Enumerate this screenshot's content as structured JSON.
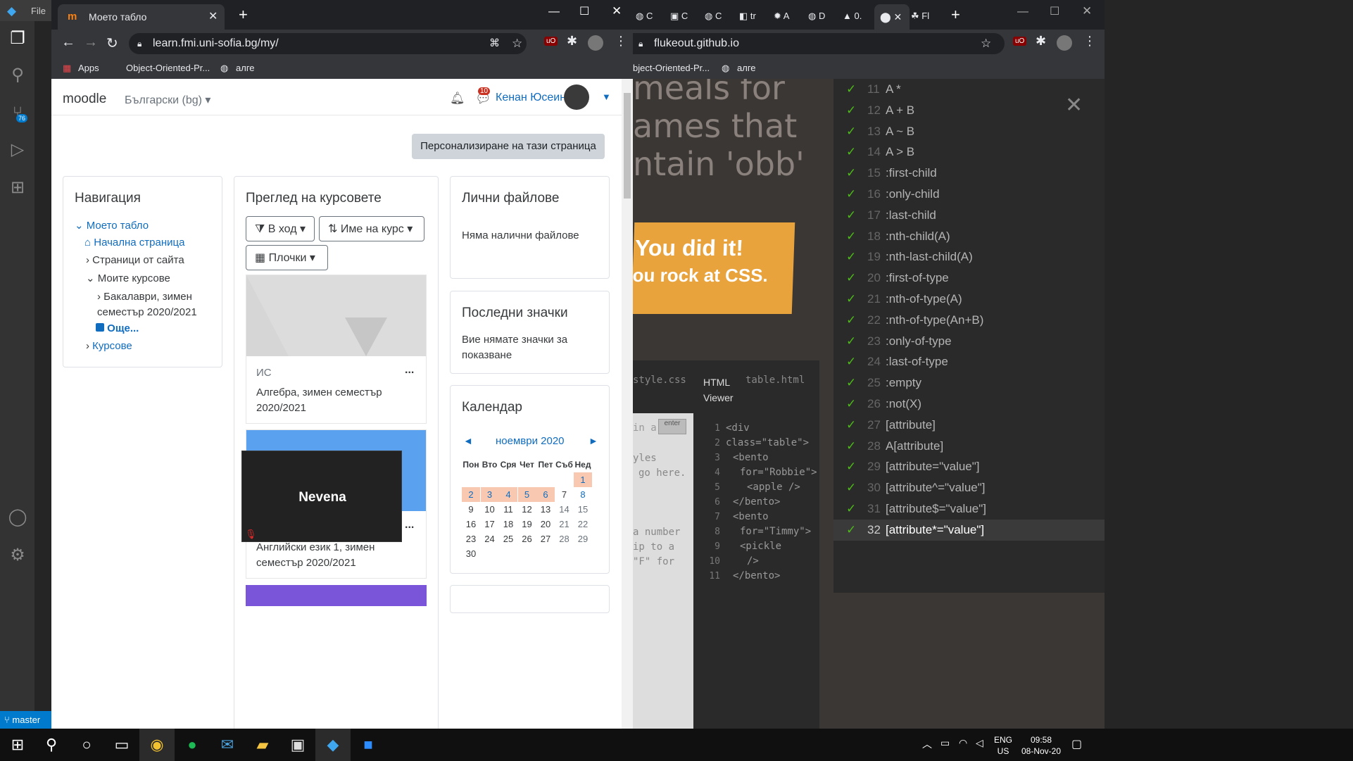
{
  "vscode": {
    "menu_file": "File",
    "scm_badge": "76",
    "branch": "master"
  },
  "chrome_left": {
    "tab_title": "Моето табло",
    "url": "learn.fmi.uni-sofia.bg/my/",
    "bookmarks": [
      "Apps",
      "Object-Oriented-Pr...",
      "алге"
    ]
  },
  "moodle": {
    "brand": "moodle",
    "language": "Български (bg)",
    "notif_count": "10",
    "user_name": "Кенан Юсеин",
    "customize_btn": "Персонализиране на тази страница",
    "navigation": {
      "title": "Навигация",
      "items": [
        "Моето табло",
        "Начална страница",
        "Страници от сайта",
        "Моите курсове",
        "Бакалаври, зимен",
        "семестър 2020/2021",
        "Още...",
        "Курсове"
      ]
    },
    "courses": {
      "title": "Преглед на курсовете",
      "filter": "В ход",
      "sort": "Име на курс",
      "view": "Плочки",
      "course1_cat": "ИС",
      "course1_name": "Алгебра, зимен семестър 2020/2021",
      "course2_name": "Английски език 1, зимен семестър 2020/2021",
      "more": "..."
    },
    "files": {
      "title": "Лични файлове",
      "text": "Няма налични файлове"
    },
    "badges": {
      "title": "Последни значки",
      "text": "Вие нямате значки за показване"
    },
    "calendar": {
      "title": "Календар",
      "month": "ноември 2020",
      "prev": "◄",
      "next": "►",
      "days": [
        "Пон",
        "Вто",
        "Сря",
        "Чет",
        "Пет",
        "Съб",
        "Нед"
      ],
      "weeks": [
        [
          "",
          "",
          "",
          "",
          "",
          "",
          "1"
        ],
        [
          "2",
          "3",
          "4",
          "5",
          "6",
          "7",
          "8"
        ],
        [
          "9",
          "10",
          "11",
          "12",
          "13",
          "14",
          "15"
        ],
        [
          "16",
          "17",
          "18",
          "19",
          "20",
          "21",
          "22"
        ],
        [
          "23",
          "24",
          "25",
          "26",
          "27",
          "28",
          "29"
        ],
        [
          "30",
          "",
          "",
          "",
          "",
          "",
          ""
        ]
      ]
    }
  },
  "zoom_overlay": {
    "name": "Nevena"
  },
  "chrome_right": {
    "tab_labels": [
      "C",
      "C",
      "C",
      "tr",
      "A",
      "D",
      "0.",
      "Fl"
    ],
    "url": "flukeout.github.io",
    "bookmarks": [
      "bject-Oriented-Pr...",
      "алге"
    ]
  },
  "flukeout": {
    "heading_lines": [
      "meals for",
      "ames that",
      "ntain 'obb'"
    ],
    "banner_line1": "You did it!",
    "banner_line2": "ou rock at CSS.",
    "editor_tabs": [
      "style.css",
      "HTML",
      "Viewer",
      "table.html"
    ],
    "css_hint": "in a",
    "enter_btn": "enter",
    "css_comments": [
      "yles",
      "go here.",
      "a number",
      "ip to a",
      "\"F\" for"
    ],
    "line_numbers": [
      "1",
      "2",
      "3",
      "4",
      "5",
      "6",
      "7",
      "8",
      "9",
      "10",
      "11"
    ],
    "code_lines": [
      "<div",
      "class=\"table\">",
      "<bento",
      "for=\"Robbie\">",
      "<apple />",
      "</bento>",
      "<bento",
      "for=\"Timmy\">",
      "<pickle",
      "/>",
      "</bento>"
    ],
    "levels": [
      {
        "n": "11",
        "s": "A *"
      },
      {
        "n": "12",
        "s": "A + B"
      },
      {
        "n": "13",
        "s": "A ~ B"
      },
      {
        "n": "14",
        "s": "A > B"
      },
      {
        "n": "15",
        "s": ":first-child"
      },
      {
        "n": "16",
        "s": ":only-child"
      },
      {
        "n": "17",
        "s": ":last-child"
      },
      {
        "n": "18",
        "s": ":nth-child(A)"
      },
      {
        "n": "19",
        "s": ":nth-last-child(A)"
      },
      {
        "n": "20",
        "s": ":first-of-type"
      },
      {
        "n": "21",
        "s": ":nth-of-type(A)"
      },
      {
        "n": "22",
        "s": ":nth-of-type(An+B)"
      },
      {
        "n": "23",
        "s": ":only-of-type"
      },
      {
        "n": "24",
        "s": ":last-of-type"
      },
      {
        "n": "25",
        "s": ":empty"
      },
      {
        "n": "26",
        "s": ":not(X)"
      },
      {
        "n": "27",
        "s": "[attribute]"
      },
      {
        "n": "28",
        "s": "A[attribute]"
      },
      {
        "n": "29",
        "s": "[attribute=\"value\"]"
      },
      {
        "n": "30",
        "s": "[attribute^=\"value\"]"
      },
      {
        "n": "31",
        "s": "[attribute$=\"value\"]"
      },
      {
        "n": "32",
        "s": "[attribute*=\"value\"]"
      }
    ]
  },
  "taskbar": {
    "lang1": "ENG",
    "lang2": "US",
    "time": "09:58",
    "date": "08-Nov-20"
  }
}
